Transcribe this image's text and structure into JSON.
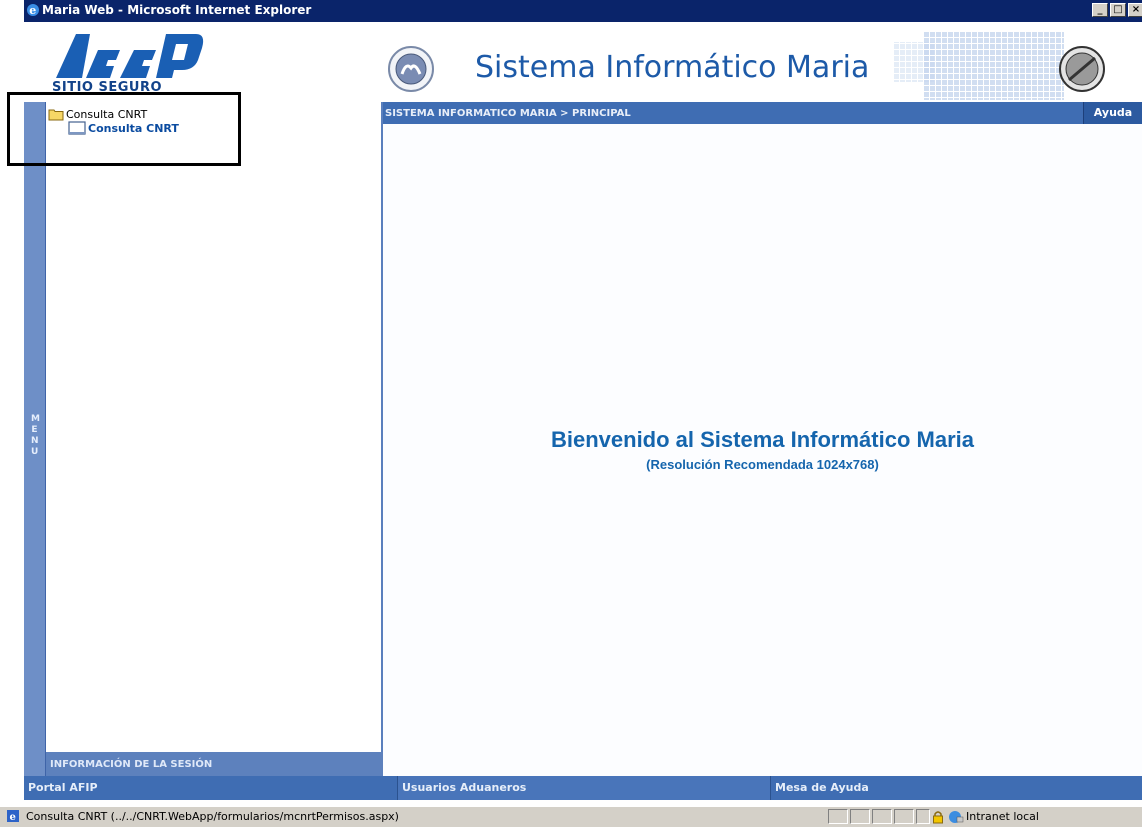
{
  "window": {
    "title": "Maria Web - Microsoft Internet Explorer",
    "min_glyph": "_",
    "max_glyph": "□",
    "close_glyph": "×"
  },
  "header": {
    "afip_subtitle": "SITIO SEGURO",
    "app_title": "Sistema Informático Maria"
  },
  "menu": {
    "strip_label": "MENU",
    "tree": {
      "folder_label": "Consulta CNRT",
      "item_label": "Consulta CNRT"
    },
    "session_label": "INFORMACIÓN DE LA SESIÓN"
  },
  "breadcrumb": {
    "path": "SISTEMA INFORMATICO MARIA > PRINCIPAL",
    "help_label": "Ayuda"
  },
  "content": {
    "welcome": "Bienvenido al Sistema Informático Maria",
    "resolution_note": "(Resolución Recomendada 1024x768)"
  },
  "footer": {
    "links": [
      "Portal AFIP",
      "Usuarios Aduaneros",
      "Mesa de Ayuda"
    ]
  },
  "statusbar": {
    "text": "Consulta CNRT (../../CNRT.WebApp/formularios/mcnrtPermisos.aspx)",
    "zone": "Intranet local"
  },
  "colors": {
    "titlebar": "#0a246a",
    "menu_blue": "#3f6db3",
    "brand_blue": "#1565ad",
    "statusbar": "#d4d0c8"
  }
}
